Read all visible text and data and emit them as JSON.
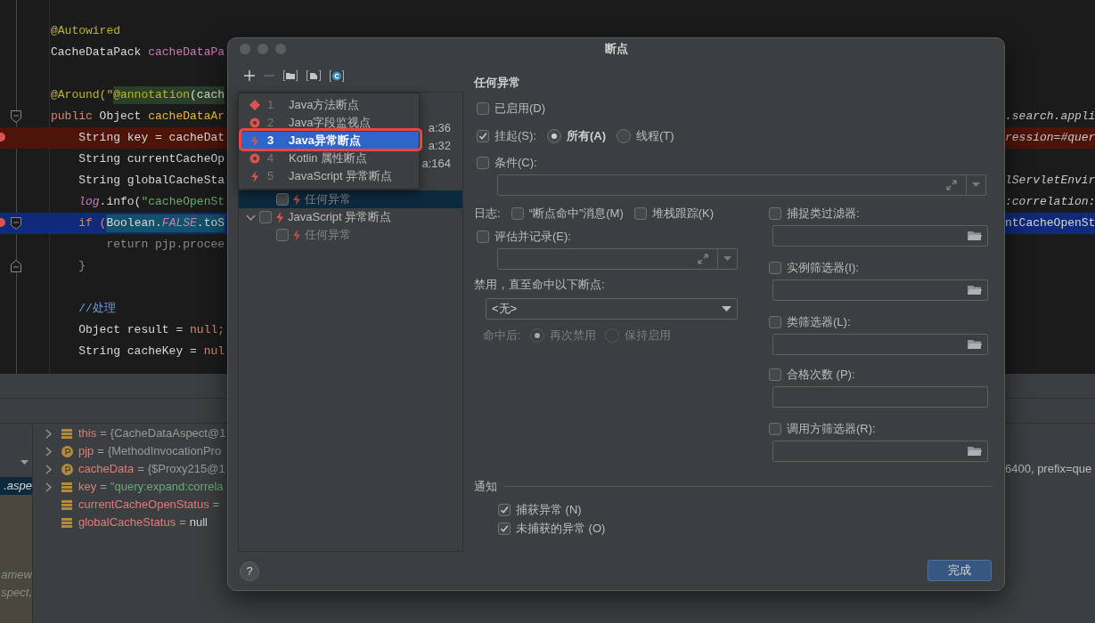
{
  "editor": {
    "lines": [
      {
        "kind": "code",
        "segments": [
          {
            "text": "@Autowired",
            "kind": "annotation"
          }
        ]
      },
      {
        "kind": "code",
        "segments": [
          {
            "text": "CacheDataPack ",
            "kind": "plain"
          },
          {
            "text": "cacheDataPa",
            "kind": "field"
          }
        ]
      },
      {
        "kind": "blank"
      },
      {
        "kind": "code",
        "segments": [
          {
            "text": "@Around(\"",
            "kind": "annotation"
          },
          {
            "text": "@annotation",
            "kind": "annotation",
            "injected": true
          },
          {
            "text": "(cach",
            "kind": "plain",
            "injected": true
          }
        ]
      },
      {
        "kind": "code",
        "fold_start": true,
        "segments": [
          {
            "text": "public ",
            "kind": "keyword"
          },
          {
            "text": "Object ",
            "kind": "plain"
          },
          {
            "text": "cacheDataAr",
            "kind": "method"
          }
        ],
        "right": {
          "text": ".search.appli",
          "kind": "italic"
        }
      },
      {
        "kind": "breakpoint",
        "breakpoint": true,
        "segments": [
          {
            "text": "    String key = cacheDat",
            "kind": "plain"
          }
        ],
        "right": {
          "text": "ression=#quer",
          "kind": "italic"
        }
      },
      {
        "kind": "code",
        "segments": [
          {
            "text": "    String currentCacheOp",
            "kind": "plain"
          }
        ]
      },
      {
        "kind": "code",
        "segments": [
          {
            "text": "    String globalCacheSta",
            "kind": "plain"
          }
        ],
        "right": {
          "text": "lServletEnvir",
          "kind": "italic"
        }
      },
      {
        "kind": "code",
        "segments": [
          {
            "text": "    log",
            "kind": "static"
          },
          {
            "text": ".info(",
            "kind": "plain"
          },
          {
            "text": "\"cacheOpenSt",
            "kind": "string"
          }
        ],
        "right": {
          "text": ":correlation:",
          "kind": "italic"
        }
      },
      {
        "kind": "execution",
        "breakpoint": true,
        "fold_start": true,
        "segments": [
          {
            "text": "    if (",
            "kind": "keyword"
          },
          {
            "text": "Boolean.",
            "kind": "plain",
            "selected": true
          },
          {
            "text": "FALSE",
            "kind": "constant",
            "selected": true
          },
          {
            "text": ".toS",
            "kind": "plain",
            "selected": true
          }
        ],
        "right": {
          "text": "ntCacheOpenSt",
          "kind": "plain"
        }
      },
      {
        "kind": "code",
        "segments": [
          {
            "text": "        return pjp.procee",
            "kind": "dimmed"
          }
        ]
      },
      {
        "kind": "code",
        "fold_end": true,
        "segments": [
          {
            "text": "    }",
            "kind": "dimmed"
          }
        ]
      },
      {
        "kind": "blank"
      },
      {
        "kind": "code",
        "segments": [
          {
            "text": "    //处理",
            "kind": "comment"
          }
        ]
      },
      {
        "kind": "code",
        "segments": [
          {
            "text": "    Object result = ",
            "kind": "plain"
          },
          {
            "text": "null;",
            "kind": "keyword"
          }
        ]
      },
      {
        "kind": "code",
        "segments": [
          {
            "text": "    String cacheKey = ",
            "kind": "plain"
          },
          {
            "text": "nul",
            "kind": "keyword"
          }
        ]
      }
    ]
  },
  "debugger": {
    "frames": [
      {
        "text": ".aspe",
        "selected": true
      },
      {
        "text": "amew",
        "selected": false
      },
      {
        "text": "spect,",
        "selected": false
      }
    ],
    "variables": [
      {
        "kind": "field",
        "expandable": true,
        "name": "this",
        "operator": "=",
        "value": {
          "text": "{CacheDataAspect@1",
          "kind": "object"
        }
      },
      {
        "kind": "parameter",
        "expandable": true,
        "name": "pjp",
        "operator": "=",
        "value": {
          "text": "{MethodInvocationPro",
          "kind": "object"
        }
      },
      {
        "kind": "parameter",
        "expandable": true,
        "name": "cacheData",
        "operator": "=",
        "value": {
          "text": "{$Proxy215@1",
          "kind": "object"
        },
        "right": "6400, prefix=que"
      },
      {
        "kind": "field",
        "expandable": true,
        "name": "key",
        "operator": "=",
        "value": {
          "text": "\"query:expand:correla",
          "kind": "string"
        }
      },
      {
        "kind": "field",
        "expandable": false,
        "name": "currentCacheOpenStatus",
        "operator": "="
      },
      {
        "kind": "field",
        "expandable": false,
        "name": "globalCacheStatus",
        "operator": "=",
        "value": {
          "text": "null",
          "kind": "null"
        }
      }
    ]
  },
  "dialog": {
    "title": "断点",
    "tree": {
      "partial_rows": [
        "a:36",
        "a:32",
        "a:164"
      ],
      "nodes": [
        {
          "label": "任何异常",
          "checked": false,
          "selected": true,
          "disabled": true
        },
        {
          "label": "JavaScript 异常断点",
          "checked": false,
          "selected": false,
          "disabled": false,
          "expanded": true,
          "children": [
            {
              "label": "任何异常",
              "checked": false,
              "selected": false,
              "disabled": true
            }
          ]
        }
      ]
    },
    "menu": [
      {
        "number": "1",
        "label": "Java方法断点",
        "kind": "method",
        "selected": false
      },
      {
        "number": "2",
        "label": "Java字段监视点",
        "kind": "watch",
        "selected": false
      },
      {
        "number": "3",
        "label": "Java异常断点",
        "kind": "exception",
        "selected": true
      },
      {
        "number": "4",
        "label": "Kotlin 属性断点",
        "kind": "watch",
        "selected": false
      },
      {
        "number": "5",
        "label": "JavaScript 异常断点",
        "kind": "exception",
        "selected": false
      }
    ],
    "detail": {
      "title": "任何异常",
      "enabled": {
        "label": "已启用(D)",
        "checked": false
      },
      "suspend": {
        "label": "挂起(S):",
        "checked": true,
        "options": [
          {
            "label": "所有(A)",
            "selected": true
          },
          {
            "label": "线程(T)",
            "selected": false
          }
        ]
      },
      "condition": {
        "label": "条件(C):",
        "checked": false
      },
      "log": {
        "label": "日志:",
        "options": [
          {
            "label": "“断点命中”消息(M)",
            "checked": false
          },
          {
            "label": "堆栈跟踪(K)",
            "checked": false
          }
        ]
      },
      "evaluate": {
        "label": "评估并记录(E):",
        "checked": false
      },
      "disable_until": {
        "label": "禁用，直至命中以下断点:",
        "value": "<无>"
      },
      "after_hit": {
        "label": "命中后:",
        "disabled": true,
        "options": [
          {
            "label": "再次禁用",
            "selected": true
          },
          {
            "label": "保持启用",
            "selected": false
          }
        ]
      },
      "filters": [
        {
          "label": "捕捉类过滤器:",
          "checked": false,
          "browse": true
        },
        {
          "label": "实例筛选器(I):",
          "checked": false,
          "browse": true
        },
        {
          "label": "类筛选器(L):",
          "checked": false,
          "browse": true
        },
        {
          "label": "合格次数 (P):",
          "checked": false,
          "browse": false
        },
        {
          "label": "调用方筛选器(R):",
          "checked": false,
          "browse": true
        }
      ],
      "notify": {
        "title": "通知",
        "options": [
          {
            "label": "捕获异常 (N)",
            "checked": true
          },
          {
            "label": "未捕获的异常 (O)",
            "checked": true
          }
        ]
      }
    },
    "help_button": "?",
    "done_button": "完成"
  }
}
